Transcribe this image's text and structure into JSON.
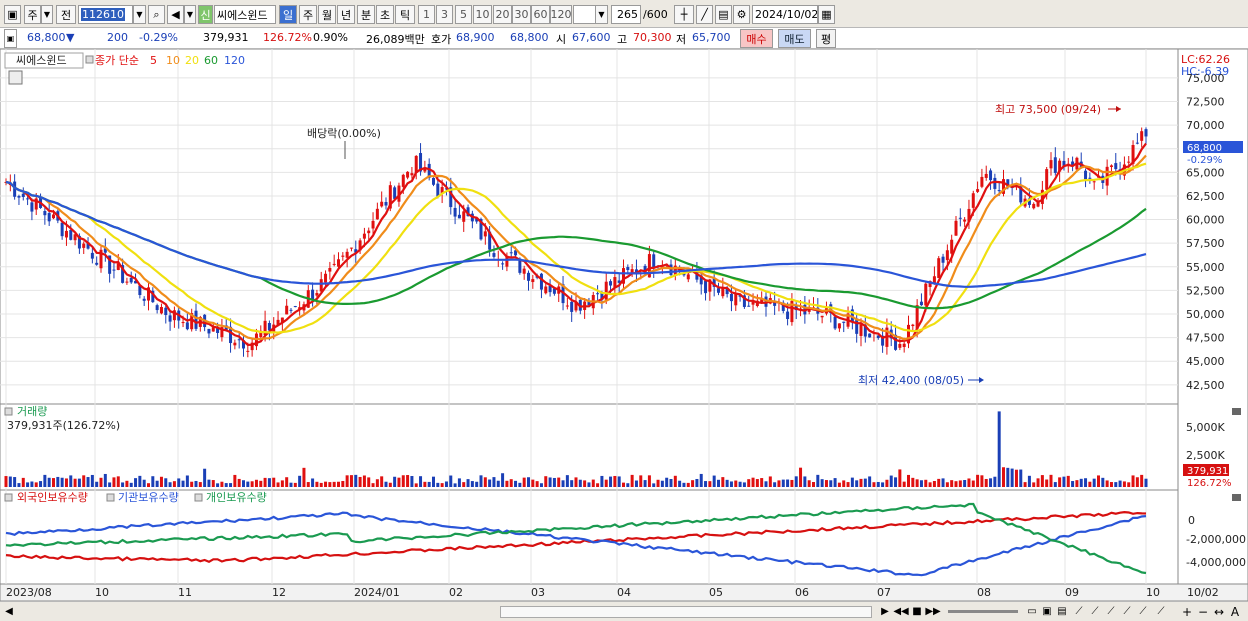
{
  "toolbar": {
    "type_week": "주",
    "prev_label": "전",
    "code": "112610",
    "stock_name": "씨에스윈드",
    "new_badge": "신",
    "periods": [
      "일",
      "주",
      "월",
      "년",
      "분",
      "초",
      "틱"
    ],
    "active_period": "일",
    "intervals": [
      "1",
      "3",
      "5",
      "10",
      "20",
      "30",
      "60",
      "120"
    ],
    "count": "265",
    "count_total": "/600",
    "date": "2024/10/02"
  },
  "infobar": {
    "price": "68,800",
    "change_arrow": "▼",
    "change": "200",
    "change_pct": "-0.29%",
    "volume": "379,931",
    "vol_ratio": "126.72%",
    "turnover": "0.90%",
    "amount": "26,089백만",
    "ask_label": "호가",
    "ask": "68,900",
    "bid": "68,800",
    "open_label": "시",
    "open": "67,600",
    "high_label": "고",
    "high": "70,300",
    "low_label": "저",
    "low": "65,700",
    "buy_btn": "매수",
    "sell_btn": "매도",
    "eval_btn": "평"
  },
  "price_panel": {
    "legend_name": "씨에스윈드",
    "legend_ma_title": "종가 단순",
    "ma_periods": [
      {
        "label": "5",
        "color": "#e01010"
      },
      {
        "label": "10",
        "color": "#f08c1a"
      },
      {
        "label": "20",
        "color": "#f0e010"
      },
      {
        "label": "60",
        "color": "#1a9a30"
      },
      {
        "label": "120",
        "color": "#2a55d8"
      }
    ],
    "lc": "LC:62.26",
    "hc": "HC:-6.39",
    "y_ticks": [
      "75,000",
      "72,500",
      "70,000",
      "67,500",
      "65,000",
      "62,500",
      "60,000",
      "57,500",
      "55,000",
      "52,500",
      "50,000",
      "47,500",
      "45,000",
      "42,500"
    ],
    "current_price_tag": "68,800",
    "current_change_tag": "-0.29%",
    "high_note": "최고 73,500 (09/24)",
    "low_note": "최저 42,400 (08/05)",
    "dividend_note": "배당락(0.00%)"
  },
  "volume_panel": {
    "title": "거래량",
    "value": "379,931주(126.72%)",
    "y_ticks": [
      "5,000K",
      "2,500K"
    ],
    "tag_value": "379,931",
    "tag_pct": "126.72%"
  },
  "holding_panel": {
    "legend": [
      {
        "label": "외국인보유수량",
        "color": "#d61010"
      },
      {
        "label": "기관보유수량",
        "color": "#2a55d8"
      },
      {
        "label": "개인보유수량",
        "color": "#1a9a50"
      }
    ],
    "y_ticks": [
      "0",
      "-2,000,000",
      "-4,000,000"
    ]
  },
  "x_axis": {
    "labels": [
      "2023/08",
      "10",
      "11",
      "12",
      "2024/01",
      "02",
      "03",
      "04",
      "05",
      "06",
      "07",
      "08",
      "09",
      "10"
    ],
    "right_label": "10/02"
  },
  "colors": {
    "up": "#e01010",
    "down": "#1a3fb6",
    "ma5": "#e01010",
    "ma10": "#f08c1a",
    "ma20": "#f0e010",
    "ma60": "#1a9a30",
    "ma120": "#2a55d8"
  },
  "chart_data": {
    "type": "line",
    "title": "씨에스윈드",
    "y_range": [
      41000,
      77000
    ],
    "key_points": [
      {
        "label": "최고",
        "value": 73500,
        "date": "09/24"
      },
      {
        "label": "최저",
        "value": 42400,
        "date": "08/05"
      }
    ],
    "approx_close": {
      "dates": [
        "2023/08",
        "2023/09",
        "2023/10",
        "2023/11",
        "2023/12",
        "2024/01",
        "2024/02",
        "2024/03",
        "2024/04",
        "2024/05",
        "2024/06",
        "2024/07",
        "2024/08",
        "2024/09",
        "2024/10/02"
      ],
      "values": [
        64000,
        57000,
        50000,
        47000,
        54000,
        66000,
        57000,
        51000,
        56000,
        51000,
        50000,
        47000,
        65000,
        60000,
        68800
      ]
    }
  }
}
